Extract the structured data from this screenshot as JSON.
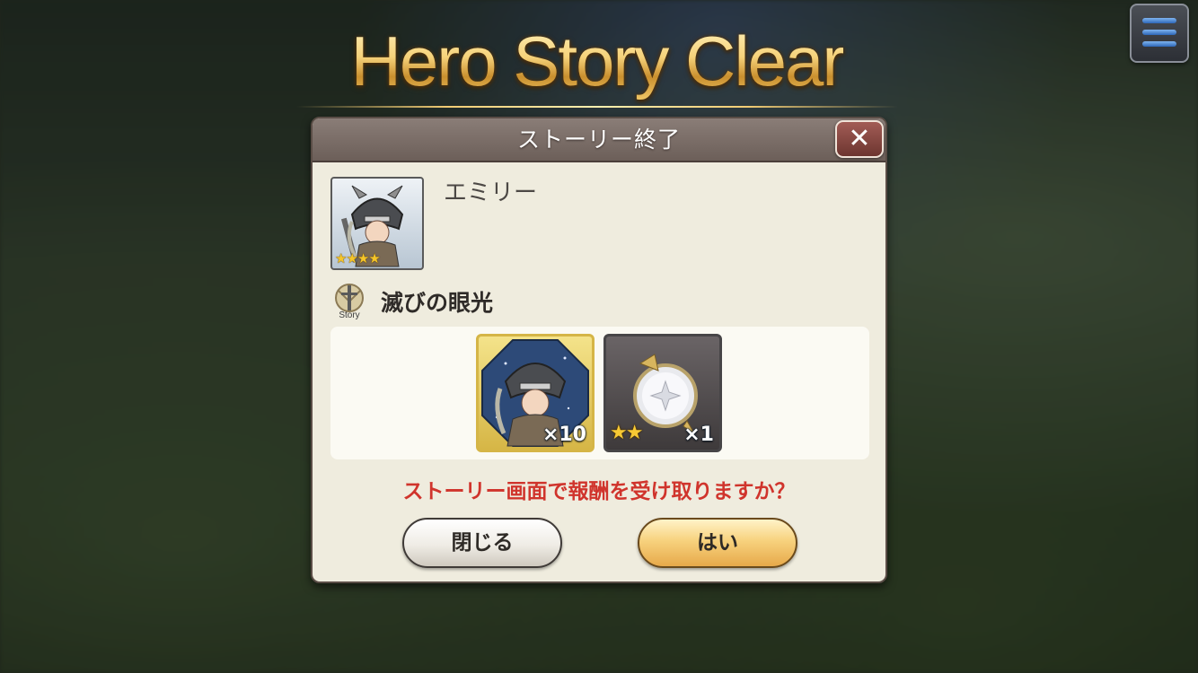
{
  "banner": {
    "title": "Hero Story Clear"
  },
  "menu": {
    "icon": "hamburger-menu-icon"
  },
  "dialog": {
    "title": "ストーリー終了",
    "close_icon": "close-x-icon",
    "hero": {
      "name": "エミリー",
      "rarity_stars": "★★★★",
      "portrait_icon": "helmeted-warrior-portrait"
    },
    "story": {
      "icon": "story-sword-icon",
      "icon_label": "Story",
      "name": "滅びの眼光"
    },
    "rewards": [
      {
        "icon": "hero-shard-portrait",
        "count": "×10"
      },
      {
        "icon": "crystal-orb-item",
        "stars": "★★",
        "count": "×1"
      }
    ],
    "prompt": "ストーリー画面で報酬を受け取りますか？",
    "buttons": {
      "close": "閉じる",
      "yes": "はい"
    }
  },
  "colors": {
    "prompt_red": "#d0342c",
    "title_gold": "#f3d27a",
    "dialog_bg": "#efecde",
    "header_bg": "#7a6d67"
  }
}
